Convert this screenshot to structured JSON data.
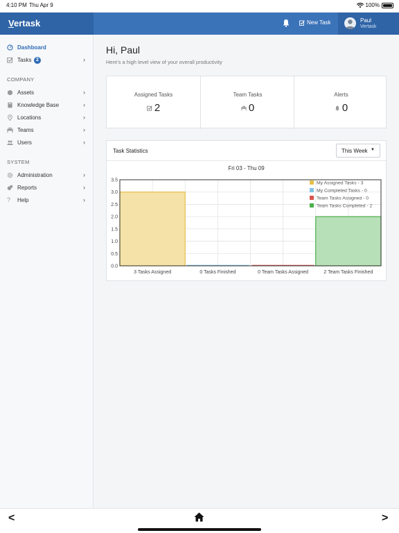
{
  "status_bar": {
    "time": "4:10 PM",
    "date": "Thu Apr 9",
    "battery": "100%"
  },
  "header": {
    "brand_initial": "V",
    "brand_rest": "ertask",
    "new_task_label": "New Task",
    "user_name": "Paul",
    "user_org": "Vertask"
  },
  "sidebar": {
    "dashboard": "Dashboard",
    "tasks": "Tasks",
    "tasks_badge": "2",
    "company_heading": "COMPANY",
    "assets": "Assets",
    "knowledge_base": "Knowledge Base",
    "locations": "Locations",
    "teams": "Teams",
    "users": "Users",
    "system_heading": "SYSTEM",
    "administration": "Administration",
    "reports": "Reports",
    "help": "Help"
  },
  "main": {
    "greeting": "Hi, Paul",
    "subtitle": "Here's a high level view of your overall productivity",
    "stats": {
      "assigned_label": "Assigned Tasks",
      "assigned_value": "2",
      "team_label": "Team Tasks",
      "team_value": "0",
      "alerts_label": "Alerts",
      "alerts_value": "0"
    },
    "card_title": "Task Statistics",
    "period_select": "This Week"
  },
  "chart_data": {
    "type": "bar",
    "title": "Fri 03 - Thu 09",
    "categories": [
      "3 Tasks Assigned",
      "0 Tasks Finished",
      "0 Team Tasks Assigned",
      "2 Team Tasks Finished"
    ],
    "series": [
      {
        "name": "My Assigned Tasks - 3",
        "values": [
          3,
          0,
          0,
          0
        ],
        "color": "#f5e2a8",
        "border": "#e6c04a"
      },
      {
        "name": "My Completed Tasks - 0",
        "values": [
          0,
          0,
          0,
          0
        ],
        "color": "#bfe3f2",
        "border": "#7fc4e4"
      },
      {
        "name": "Team Tasks Assigned - 0",
        "values": [
          0,
          0,
          0,
          0
        ],
        "color": "#f2b0b0",
        "border": "#d9534f"
      },
      {
        "name": "Team Tasks Completed - 2",
        "values": [
          0,
          0,
          0,
          2
        ],
        "color": "#b8e0b8",
        "border": "#4cae4c"
      }
    ],
    "ylim": [
      0,
      3.5
    ],
    "yticks": [
      "0.0",
      "0.5",
      "1.0",
      "1.5",
      "2.0",
      "2.5",
      "3.0",
      "3.5"
    ],
    "grid": true,
    "legend_position": "top-right"
  }
}
